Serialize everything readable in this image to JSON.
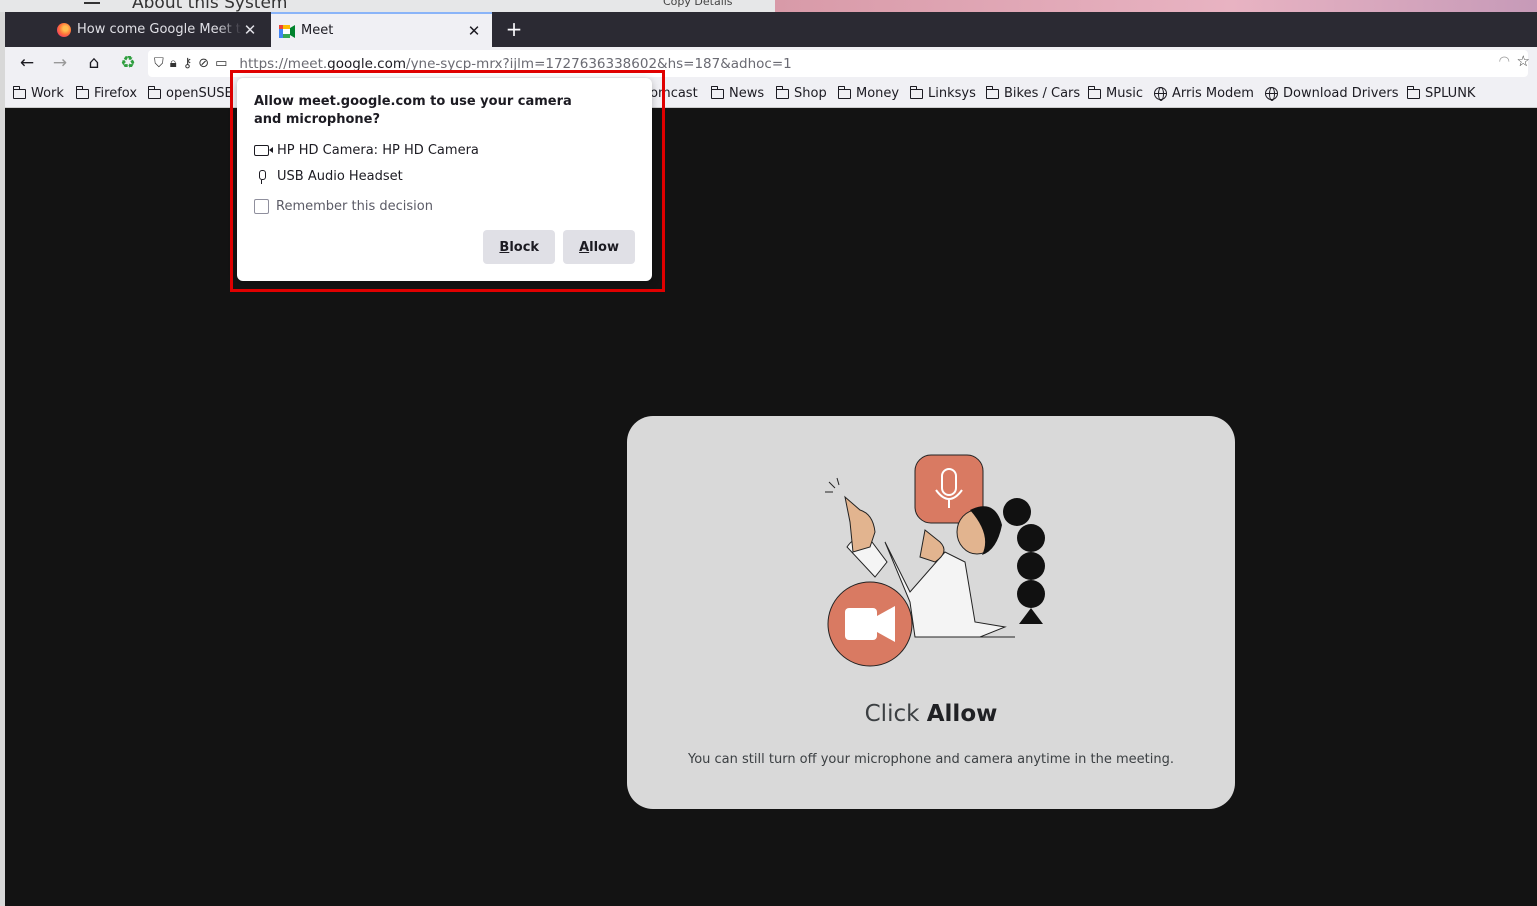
{
  "desktop": {
    "about_title": "About this System",
    "copy_label": "Copy Details"
  },
  "tabs": [
    {
      "title": "How come Google Meet takes",
      "active": false,
      "icon": "firefox-icon"
    },
    {
      "title": "Meet",
      "active": true,
      "icon": "google-meet-icon"
    }
  ],
  "url": {
    "prefix": "https://meet.",
    "domain": "google.com",
    "rest": "/yne-sycp-mrx?ijlm=1727636338602&hs=187&adhoc=1"
  },
  "bookmarks": [
    {
      "label": "Work",
      "icon": "folder-icon"
    },
    {
      "label": "Firefox",
      "icon": "folder-icon"
    },
    {
      "label": "openSUSE",
      "icon": "folder-icon"
    },
    {
      "label": "Comcast",
      "icon": "folder-icon"
    },
    {
      "label": "News",
      "icon": "folder-icon"
    },
    {
      "label": "Shop",
      "icon": "folder-icon"
    },
    {
      "label": "Money",
      "icon": "folder-icon"
    },
    {
      "label": "Linksys",
      "icon": "folder-icon"
    },
    {
      "label": "Bikes / Cars",
      "icon": "folder-icon"
    },
    {
      "label": "Music",
      "icon": "folder-icon"
    },
    {
      "label": "Arris Modem",
      "icon": "globe-icon"
    },
    {
      "label": "Download Drivers",
      "icon": "globe-icon"
    },
    {
      "label": "SPLUNK",
      "icon": "folder-icon"
    }
  ],
  "popup": {
    "title": "Allow meet.google.com to use your camera and microphone?",
    "camera": "HP HD Camera: HP HD Camera",
    "microphone": "USB Audio Headset",
    "remember": "Remember this decision",
    "block_first": "B",
    "block_rest": "lock",
    "allow_first": "A",
    "allow_rest": "llow",
    "highlight_color": "#e00000"
  },
  "card": {
    "title_prefix": "Click ",
    "title_bold": "Allow",
    "subtitle": "You can still turn off your microphone and camera anytime in the meeting.",
    "accent_color": "#d97a62"
  }
}
